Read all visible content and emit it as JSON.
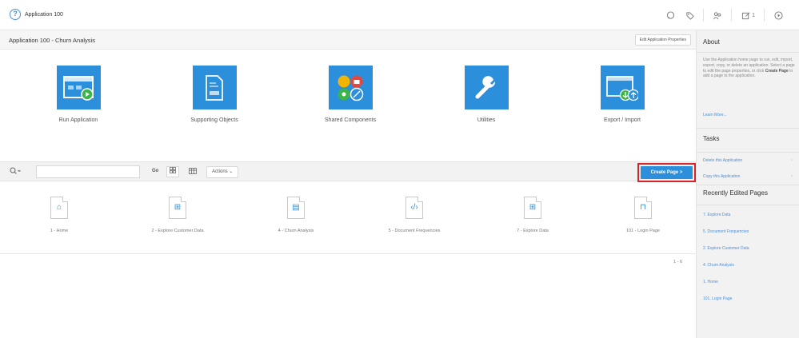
{
  "topbar": {
    "app_icon": "question-icon",
    "app_title": "Application 100",
    "icons": [
      "comment-icon",
      "tag-icon",
      "team-icon",
      "edit-icon",
      "play-icon"
    ],
    "edit_count": "1"
  },
  "subheader": {
    "title": "Application 100 - Churn Analysis",
    "edit_properties_label": "Edit Application Properties"
  },
  "tiles": [
    {
      "label": "Run Application",
      "icon": "window-play-icon"
    },
    {
      "label": "Supporting Objects",
      "icon": "document-sql-icon"
    },
    {
      "label": "Shared Components",
      "icon": "shared-components-icon"
    },
    {
      "label": "Utilities",
      "icon": "wrench-icon"
    },
    {
      "label": "Export / Import",
      "icon": "export-import-icon"
    }
  ],
  "toolbar": {
    "search_value": "",
    "go_label": "Go",
    "actions_label": "Actions",
    "create_page_label": "Create Page >"
  },
  "pages": [
    {
      "label": "1 - Home",
      "icon": "home-icon"
    },
    {
      "label": "2 - Explore Customer Data",
      "icon": "grid-icon"
    },
    {
      "label": "4 - Churn Analysis",
      "icon": "chart-icon"
    },
    {
      "label": "5 - Document Frequencies",
      "icon": "code-icon"
    },
    {
      "label": "7 - Explore Data",
      "icon": "grid-icon"
    },
    {
      "label": "101 - Login Page",
      "icon": "lock-icon"
    }
  ],
  "pagination": "1 - 6",
  "sidebar": {
    "about_title": "About",
    "about_text_1": "Use the Application home page to run, edit, import, export, copy, or delete an application. Select a page to edit the page properties, or click",
    "about_text_bold": "Create Page",
    "about_text_2": "to add a page to the application.",
    "learn_more": "Learn More...",
    "tasks_title": "Tasks",
    "tasks": [
      "Delete this Application",
      "Copy this Application"
    ],
    "recent_title": "Recently Edited Pages",
    "recent": [
      "7. Explore Data",
      "5. Document Frequencies",
      "2. Explore Customer Data",
      "4. Churn Analysis",
      "1. Home",
      "101. Login Page"
    ]
  },
  "colors": {
    "accent": "#2b8fdb",
    "highlight": "#d8232a"
  }
}
